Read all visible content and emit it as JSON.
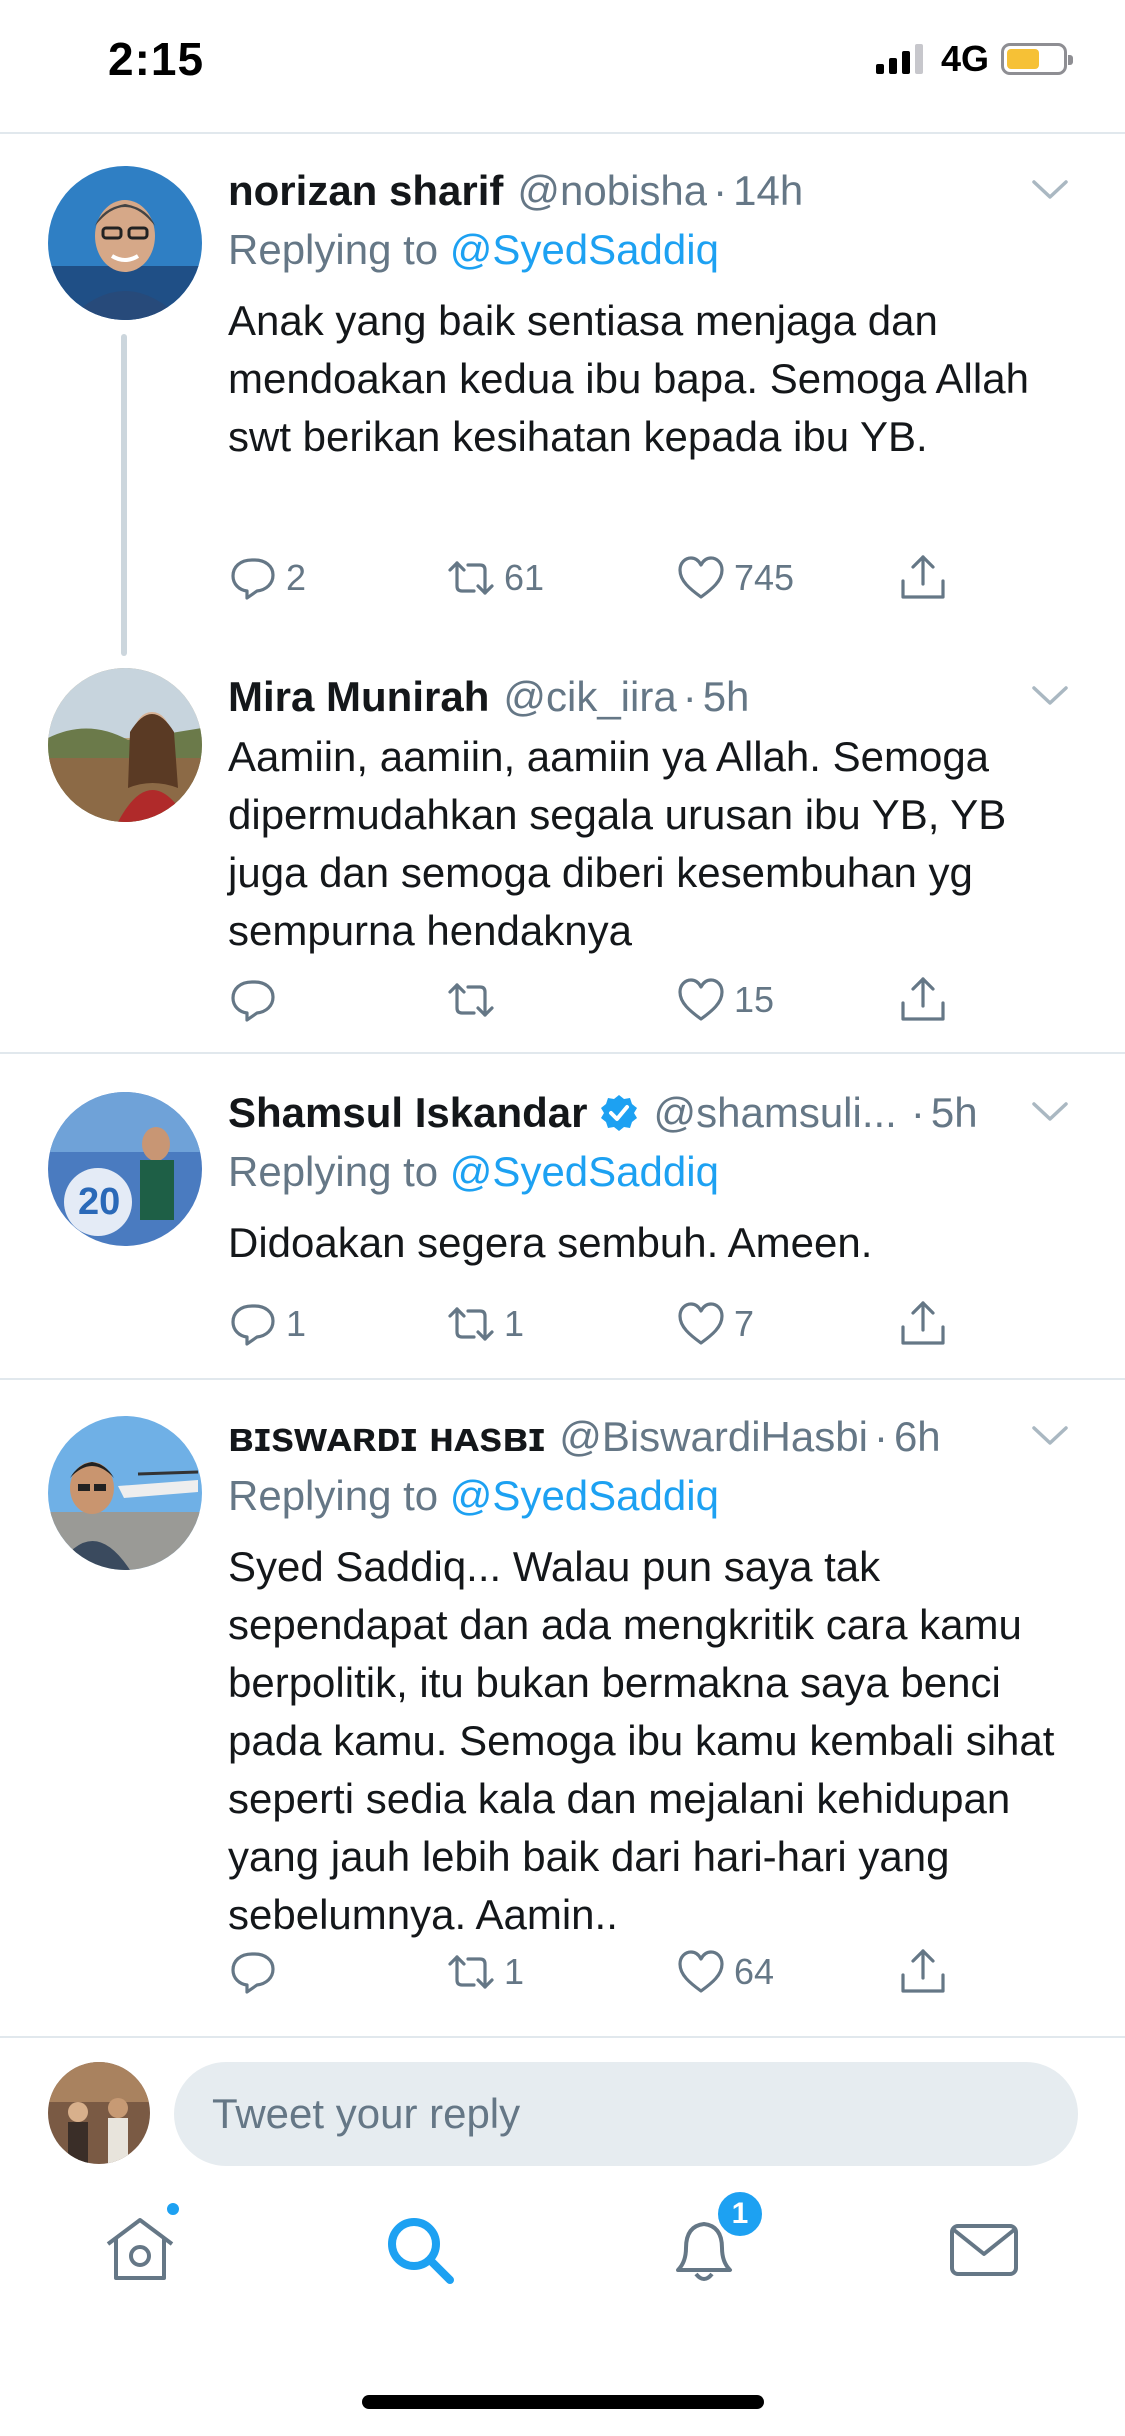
{
  "status_bar": {
    "time": "2:15",
    "network": "4G",
    "battery_color": "#f6c136"
  },
  "tweets": [
    {
      "name": "norizan sharif",
      "handle": "@nobisha",
      "time": "14h",
      "replying_prefix": "Replying to",
      "replying_to": "@SyedSaddiq",
      "text": "Anak yang baik sentiasa menjaga dan mendoakan kedua ibu bapa. Semoga Allah swt berikan kesihatan kepada ibu YB.",
      "replies": "2",
      "retweets": "61",
      "likes": "745"
    },
    {
      "name": "Mira Munirah",
      "handle": "@cik_iira",
      "time": "5h",
      "text": "Aamiin, aamiin, aamiin ya Allah. Semoga dipermudahkan segala urusan ibu YB, YB juga dan semoga diberi kesembuhan yg sempurna hendaknya",
      "replies": "",
      "retweets": "",
      "likes": "15"
    },
    {
      "name": "Shamsul Iskandar",
      "verified": true,
      "handle": "@shamsuli...",
      "time": "5h",
      "replying_prefix": "Replying to",
      "replying_to": "@SyedSaddiq",
      "text": "Didoakan segera sembuh. Ameen.",
      "replies": "1",
      "retweets": "1",
      "likes": "7"
    },
    {
      "name": "ʙɪsᴡᴀʀᴅɪ ʜᴀsʙɪ",
      "handle": "@BiswardiHasbi",
      "time": "6h",
      "replying_prefix": "Replying to",
      "replying_to": "@SyedSaddiq",
      "text": "Syed Saddiq... Walau pun saya tak sependapat dan ada mengkritik cara kamu berpolitik, itu bukan bermakna saya benci pada kamu. Semoga ibu kamu kembali sihat seperti sedia kala dan mejalani kehidupan yang jauh lebih baik dari hari-hari yang sebelumnya. Aamin..",
      "replies": "",
      "retweets": "1",
      "likes": "64"
    }
  ],
  "composer": {
    "placeholder": "Tweet your reply"
  },
  "tabbar": {
    "notifications_badge": "1"
  },
  "colors": {
    "accent": "#1da1f2",
    "secondary_text": "#657786",
    "divider": "#e1e8ed"
  },
  "icons": [
    "reply-icon",
    "retweet-icon",
    "like-icon",
    "share-icon",
    "chevron-down-icon",
    "verified-icon",
    "home-icon",
    "search-icon",
    "notifications-icon",
    "messages-icon"
  ]
}
